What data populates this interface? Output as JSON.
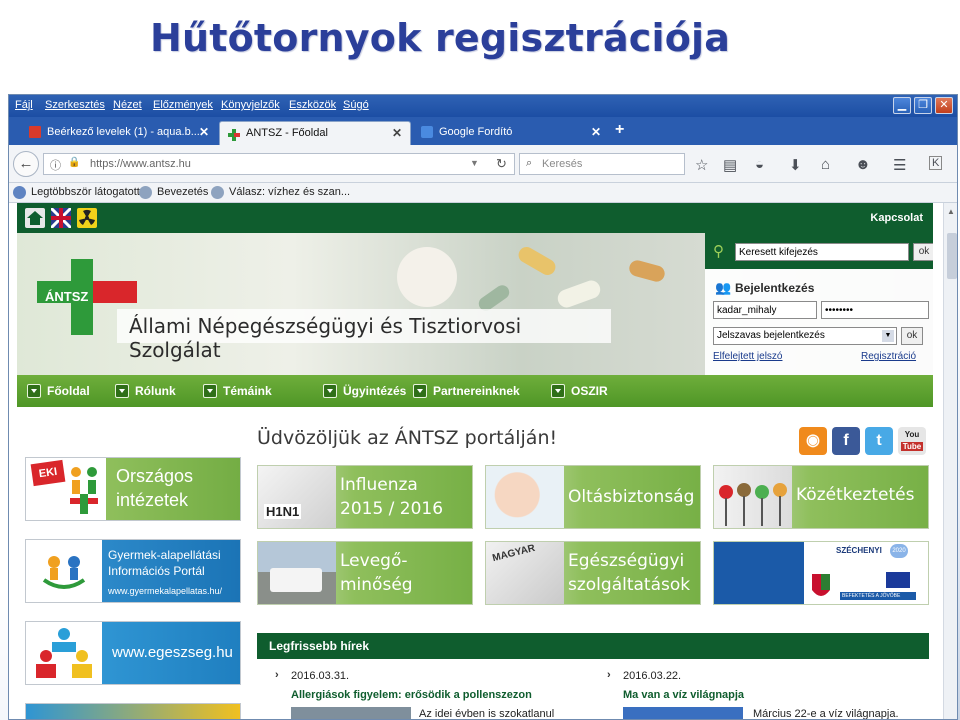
{
  "slide": {
    "title": "Hűtőtornyok regisztrációja"
  },
  "browser": {
    "menu": [
      "Fájl",
      "Szerkesztés",
      "Nézet",
      "Előzmények",
      "Könyvjelzők",
      "Eszközök",
      "Súgó"
    ],
    "tabs": [
      {
        "label": "Beérkező levelek (1) - aqua.b...",
        "icon": "gmail-icon"
      },
      {
        "label": "ANTSZ - Főoldal",
        "icon": "antsz-cross-icon"
      },
      {
        "label": "Google Fordító",
        "icon": "translate-icon"
      }
    ],
    "url": "https://www.antsz.hu",
    "search_placeholder": "Keresés",
    "bookmarks": [
      "Legtöbbször látogatott",
      "Bevezetés",
      "Válasz: vízhez és szan..."
    ]
  },
  "site": {
    "contact": "Kapcsolat",
    "logo_text": "ÁNTSZ",
    "name": "Állami Népegészségügyi és Tisztiorvosi Szolgálat",
    "search": {
      "value": "Keresett kifejezés",
      "button": "ok"
    },
    "login": {
      "title": "Bejelentkezés",
      "username": "kadar_mihaly",
      "password": "••••••••",
      "method": "Jelszavas bejelentkezés",
      "button": "ok",
      "forgot": "Elfelejtett jelszó",
      "register": "Regisztráció"
    },
    "nav": [
      "Főoldal",
      "Rólunk",
      "Témáink",
      "Ügyintézés",
      "Partnereinknek",
      "OSZIR"
    ],
    "welcome": "Üdvözöljük az ÁNTSZ portálján!",
    "social": [
      "RSS",
      "f",
      "t",
      "You Tube"
    ],
    "side_banners": {
      "orszagos": {
        "line1": "Országos",
        "line2": "intézetek",
        "badge": "EKI"
      },
      "gyermek": {
        "line1": "Gyermek-alapellátási",
        "line2": "Információs Portál",
        "url": "www.gyermekalapellatas.hu/"
      },
      "egeszseg": {
        "text": "www.egeszseg.hu"
      }
    },
    "tiles": {
      "influenza": {
        "line1": "Influenza",
        "line2": "2015 / 2016",
        "img_text": "H1N1"
      },
      "oltas": {
        "text": "Oltásbiztonság"
      },
      "kozet": {
        "text": "Közétkeztetés"
      },
      "levego": {
        "line1": "Levegő-",
        "line2": "minőség"
      },
      "egeszsegugyi": {
        "line1": "Egészségügyi",
        "line2": "szolgáltatások",
        "img_text": "MAGYAR"
      },
      "szechenyi": {
        "title": "SZÉCHENYI",
        "year": "2020",
        "tagline": "BEFEKTETÉS A JÖVŐBE"
      }
    },
    "news": {
      "title": "Legfrissebb hírek",
      "items": [
        {
          "date": "2016.03.31.",
          "headline": "Allergiások figyelem: erősödik a pollenszezon",
          "snippet": "Az idei évben is szokatlanul"
        },
        {
          "date": "2016.03.22.",
          "headline": "Ma van a víz világnapja",
          "snippet": "Március 22-e a víz világnapja."
        }
      ]
    }
  }
}
